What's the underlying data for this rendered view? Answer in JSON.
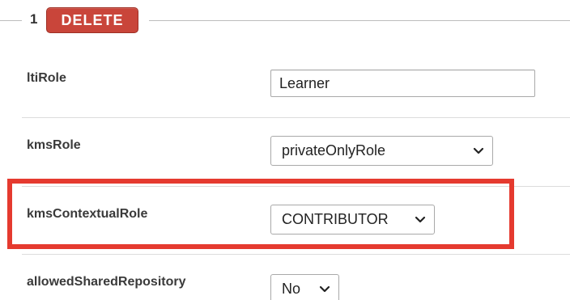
{
  "fieldset": {
    "index": "1",
    "delete_label": "DELETE"
  },
  "fields": {
    "ltiRole": {
      "label": "ltiRole",
      "value": "Learner"
    },
    "kmsRole": {
      "label": "kmsRole",
      "value": "privateOnlyRole"
    },
    "kmsContextualRole": {
      "label": "kmsContextualRole",
      "value": "CONTRIBUTOR"
    },
    "allowedSharedRepository": {
      "label": "allowedSharedRepository",
      "value": "No"
    }
  },
  "colors": {
    "delete_button": "#c9453a",
    "highlight": "#e53a2f"
  },
  "icons": [
    "chevron-down-icon"
  ]
}
